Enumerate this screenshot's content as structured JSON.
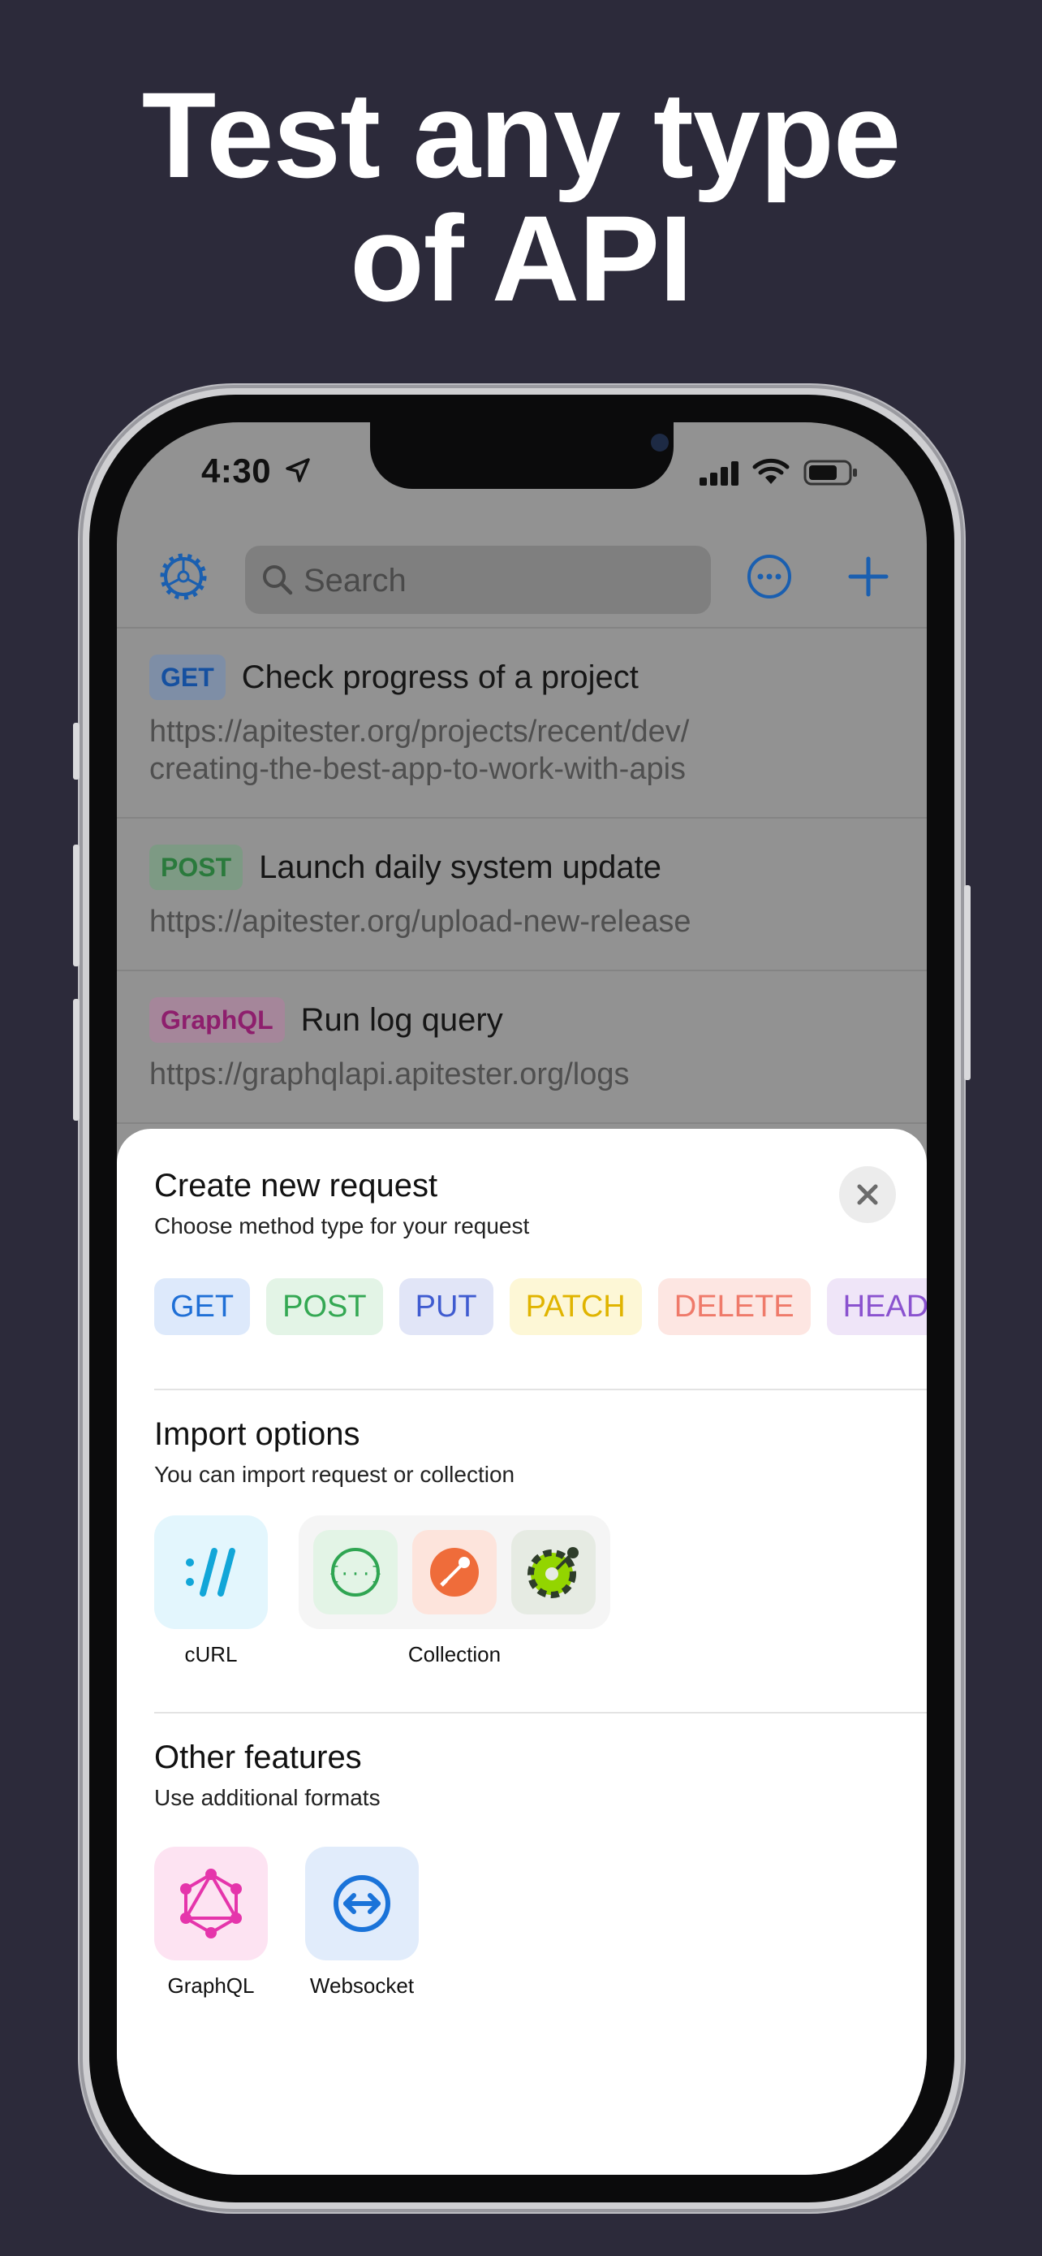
{
  "headline": {
    "line1": "Test any type",
    "line2": "of API"
  },
  "status_bar": {
    "time": "4:30"
  },
  "toolbar": {
    "search_placeholder": "Search"
  },
  "requests": [
    {
      "method": "GET",
      "title": "Check progress of a project",
      "url_line1": "https://apitester.org/projects/recent/dev/",
      "url_line2": "creating-the-best-app-to-work-with-apis"
    },
    {
      "method": "POST",
      "title": "Launch daily system update",
      "url_line1": "https://apitester.org/upload-new-release"
    },
    {
      "method": "GraphQL",
      "title": "Run log query",
      "url_line1": "https://graphqlapi.apitester.org/logs"
    }
  ],
  "sheet": {
    "create": {
      "title": "Create new request",
      "subtitle": "Choose method type for your request",
      "methods": [
        "GET",
        "POST",
        "PUT",
        "PATCH",
        "DELETE",
        "HEAD"
      ]
    },
    "import": {
      "title": "Import options",
      "subtitle": "You can import request or collection",
      "curl_label": "cURL",
      "collection_label": "Collection"
    },
    "other": {
      "title": "Other features",
      "subtitle": "Use additional formats",
      "graphql_label": "GraphQL",
      "websocket_label": "Websocket"
    }
  },
  "colors": {
    "background": "#2c2a3a",
    "accent": "#1a73d9",
    "get": "#1f6fd6",
    "post": "#34a853",
    "put": "#3f5bd0",
    "patch": "#e0b400",
    "delete": "#ef7a6a",
    "head": "#8a52cf",
    "graphql": "#b0268a"
  },
  "icons": {
    "settings": "gear-icon",
    "search": "search-icon",
    "more": "ellipsis-circle-icon",
    "add": "plus-icon",
    "close": "close-icon",
    "curl": "curl-icon",
    "json": "json-braces-icon",
    "postman": "postman-icon",
    "openapi": "openapi-icon",
    "graphql": "graphql-icon",
    "websocket": "websocket-icon"
  }
}
